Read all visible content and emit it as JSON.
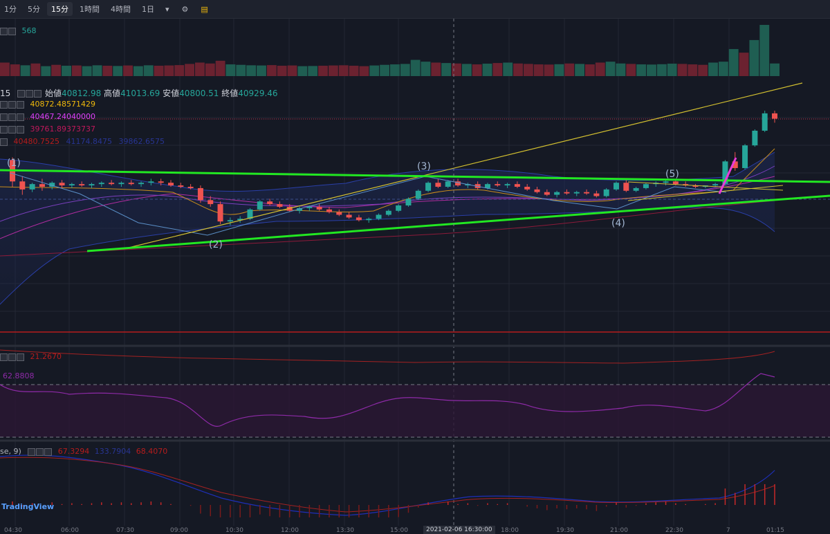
{
  "toolbar": {
    "timeframes": [
      "1分",
      "5分",
      "15分",
      "1時間",
      "4時間",
      "1日"
    ],
    "active": "15分"
  },
  "legend": {
    "volume": "568",
    "interval_fragment": "15",
    "ohlc": {
      "open_label": "始値",
      "open": "40812.98",
      "high_label": "高値",
      "high": "41013.69",
      "low_label": "安値",
      "low": "40800.51",
      "close_label": "終値",
      "close": "40929.46"
    },
    "ma1": "40872.48571429",
    "ma2": "40467.24040000",
    "ma3": "39761.89373737",
    "bb_1": "40480.7525",
    "bb_2": "41174.8475",
    "bb_3": "39862.6575",
    "adx": "21.2670",
    "rsi": "62.8808",
    "macd_param": "se, 9)",
    "macd_1": "67.3294",
    "macd_2": "133.7904",
    "macd_3": "68.4070"
  },
  "waves": [
    "(1)",
    "(2)",
    "(3)",
    "(4)",
    "(5)"
  ],
  "time_axis": [
    "04:30",
    "06:00",
    "07:30",
    "09:00",
    "10:30",
    "12:00",
    "13:30",
    "15:00",
    "16:30",
    "18:00",
    "19:30",
    "21:00",
    "22:30",
    "7",
    "01:15"
  ],
  "crosshair_time": "2021-02-06 16:30:00",
  "watermark": "TradingView",
  "colors": {
    "up": "#26a69a",
    "down": "#ef5350",
    "bg": "#151924",
    "trend": "#00ff00",
    "channel": "#d4c130"
  },
  "chart_data": {
    "type": "candlestick",
    "candles": [
      {
        "o": 40640,
        "h": 40660,
        "l": 40440,
        "c": 40480
      },
      {
        "o": 40480,
        "h": 40520,
        "l": 40380,
        "c": 40420
      },
      {
        "o": 40420,
        "h": 40470,
        "l": 40400,
        "c": 40460
      },
      {
        "o": 40460,
        "h": 40500,
        "l": 40410,
        "c": 40440
      },
      {
        "o": 40440,
        "h": 40480,
        "l": 40420,
        "c": 40470
      },
      {
        "o": 40470,
        "h": 40490,
        "l": 40430,
        "c": 40450
      },
      {
        "o": 40450,
        "h": 40470,
        "l": 40430,
        "c": 40460
      },
      {
        "o": 40460,
        "h": 40480,
        "l": 40440,
        "c": 40450
      },
      {
        "o": 40450,
        "h": 40470,
        "l": 40430,
        "c": 40460
      },
      {
        "o": 40460,
        "h": 40480,
        "l": 40440,
        "c": 40470
      },
      {
        "o": 40470,
        "h": 40490,
        "l": 40450,
        "c": 40460
      },
      {
        "o": 40460,
        "h": 40480,
        "l": 40440,
        "c": 40470
      },
      {
        "o": 40470,
        "h": 40490,
        "l": 40450,
        "c": 40460
      },
      {
        "o": 40460,
        "h": 40480,
        "l": 40440,
        "c": 40470
      },
      {
        "o": 40470,
        "h": 40500,
        "l": 40450,
        "c": 40480
      },
      {
        "o": 40480,
        "h": 40500,
        "l": 40450,
        "c": 40470
      },
      {
        "o": 40470,
        "h": 40490,
        "l": 40440,
        "c": 40450
      },
      {
        "o": 40450,
        "h": 40470,
        "l": 40430,
        "c": 40440
      },
      {
        "o": 40440,
        "h": 40460,
        "l": 40420,
        "c": 40430
      },
      {
        "o": 40430,
        "h": 40450,
        "l": 40320,
        "c": 40340
      },
      {
        "o": 40340,
        "h": 40370,
        "l": 40290,
        "c": 40310
      },
      {
        "o": 40310,
        "h": 40330,
        "l": 40160,
        "c": 40180
      },
      {
        "o": 40180,
        "h": 40210,
        "l": 40150,
        "c": 40190
      },
      {
        "o": 40190,
        "h": 40220,
        "l": 40170,
        "c": 40200
      },
      {
        "o": 40200,
        "h": 40280,
        "l": 40190,
        "c": 40270
      },
      {
        "o": 40270,
        "h": 40340,
        "l": 40260,
        "c": 40330
      },
      {
        "o": 40330,
        "h": 40350,
        "l": 40300,
        "c": 40310
      },
      {
        "o": 40310,
        "h": 40330,
        "l": 40280,
        "c": 40290
      },
      {
        "o": 40290,
        "h": 40310,
        "l": 40250,
        "c": 40260
      },
      {
        "o": 40260,
        "h": 40290,
        "l": 40240,
        "c": 40280
      },
      {
        "o": 40280,
        "h": 40300,
        "l": 40260,
        "c": 40290
      },
      {
        "o": 40290,
        "h": 40310,
        "l": 40260,
        "c": 40270
      },
      {
        "o": 40270,
        "h": 40290,
        "l": 40240,
        "c": 40250
      },
      {
        "o": 40250,
        "h": 40270,
        "l": 40220,
        "c": 40230
      },
      {
        "o": 40230,
        "h": 40250,
        "l": 40200,
        "c": 40210
      },
      {
        "o": 40210,
        "h": 40230,
        "l": 40180,
        "c": 40190
      },
      {
        "o": 40190,
        "h": 40210,
        "l": 40170,
        "c": 40200
      },
      {
        "o": 40200,
        "h": 40240,
        "l": 40190,
        "c": 40230
      },
      {
        "o": 40230,
        "h": 40270,
        "l": 40220,
        "c": 40260
      },
      {
        "o": 40260,
        "h": 40310,
        "l": 40250,
        "c": 40300
      },
      {
        "o": 40300,
        "h": 40360,
        "l": 40290,
        "c": 40350
      },
      {
        "o": 40350,
        "h": 40420,
        "l": 40340,
        "c": 40410
      },
      {
        "o": 40410,
        "h": 40480,
        "l": 40400,
        "c": 40470
      },
      {
        "o": 40470,
        "h": 40500,
        "l": 40430,
        "c": 40440
      },
      {
        "o": 40440,
        "h": 40490,
        "l": 40430,
        "c": 40480
      },
      {
        "o": 40480,
        "h": 40500,
        "l": 40440,
        "c": 40450
      },
      {
        "o": 40450,
        "h": 40470,
        "l": 40430,
        "c": 40460
      },
      {
        "o": 40460,
        "h": 40480,
        "l": 40420,
        "c": 40430
      },
      {
        "o": 40430,
        "h": 40470,
        "l": 40420,
        "c": 40460
      },
      {
        "o": 40460,
        "h": 40480,
        "l": 40440,
        "c": 40450
      },
      {
        "o": 40450,
        "h": 40470,
        "l": 40430,
        "c": 40460
      },
      {
        "o": 40460,
        "h": 40480,
        "l": 40430,
        "c": 40440
      },
      {
        "o": 40440,
        "h": 40460,
        "l": 40410,
        "c": 40420
      },
      {
        "o": 40420,
        "h": 40440,
        "l": 40390,
        "c": 40400
      },
      {
        "o": 40400,
        "h": 40420,
        "l": 40370,
        "c": 40380
      },
      {
        "o": 40380,
        "h": 40410,
        "l": 40360,
        "c": 40400
      },
      {
        "o": 40400,
        "h": 40420,
        "l": 40380,
        "c": 40390
      },
      {
        "o": 40390,
        "h": 40410,
        "l": 40370,
        "c": 40400
      },
      {
        "o": 40400,
        "h": 40420,
        "l": 40380,
        "c": 40390
      },
      {
        "o": 40390,
        "h": 40410,
        "l": 40360,
        "c": 40370
      },
      {
        "o": 40370,
        "h": 40430,
        "l": 40360,
        "c": 40420
      },
      {
        "o": 40420,
        "h": 40480,
        "l": 40410,
        "c": 40470
      },
      {
        "o": 40470,
        "h": 40490,
        "l": 40400,
        "c": 40410
      },
      {
        "o": 40410,
        "h": 40440,
        "l": 40400,
        "c": 40430
      },
      {
        "o": 40430,
        "h": 40470,
        "l": 40420,
        "c": 40460
      },
      {
        "o": 40460,
        "h": 40480,
        "l": 40440,
        "c": 40470
      },
      {
        "o": 40470,
        "h": 40490,
        "l": 40450,
        "c": 40480
      },
      {
        "o": 40480,
        "h": 40500,
        "l": 40450,
        "c": 40460
      },
      {
        "o": 40460,
        "h": 40480,
        "l": 40440,
        "c": 40450
      },
      {
        "o": 40450,
        "h": 40460,
        "l": 40430,
        "c": 40440
      },
      {
        "o": 40440,
        "h": 40450,
        "l": 40430,
        "c": 40450
      },
      {
        "o": 40450,
        "h": 40470,
        "l": 40440,
        "c": 40460
      },
      {
        "o": 40460,
        "h": 40640,
        "l": 40450,
        "c": 40630
      },
      {
        "o": 40630,
        "h": 40700,
        "l": 40560,
        "c": 40580
      },
      {
        "o": 40580,
        "h": 40760,
        "l": 40570,
        "c": 40750
      },
      {
        "o": 40750,
        "h": 40870,
        "l": 40740,
        "c": 40860
      },
      {
        "o": 40860,
        "h": 41010,
        "l": 40850,
        "c": 40990
      },
      {
        "o": 40990,
        "h": 41010,
        "l": 40920,
        "c": 40950
      }
    ],
    "volume": [
      150,
      130,
      120,
      140,
      110,
      125,
      115,
      118,
      110,
      120,
      115,
      112,
      118,
      110,
      120,
      115,
      118,
      122,
      135,
      150,
      140,
      170,
      130,
      125,
      120,
      118,
      122,
      115,
      118,
      110,
      112,
      115,
      118,
      120,
      115,
      110,
      118,
      125,
      130,
      135,
      180,
      160,
      150,
      145,
      140,
      135,
      130,
      138,
      145,
      150,
      140,
      135,
      130,
      128,
      132,
      140,
      135,
      130,
      150,
      160,
      140,
      135,
      130,
      128,
      132,
      138,
      135,
      130,
      125,
      150,
      160,
      300,
      260,
      400,
      568,
      140
    ]
  }
}
